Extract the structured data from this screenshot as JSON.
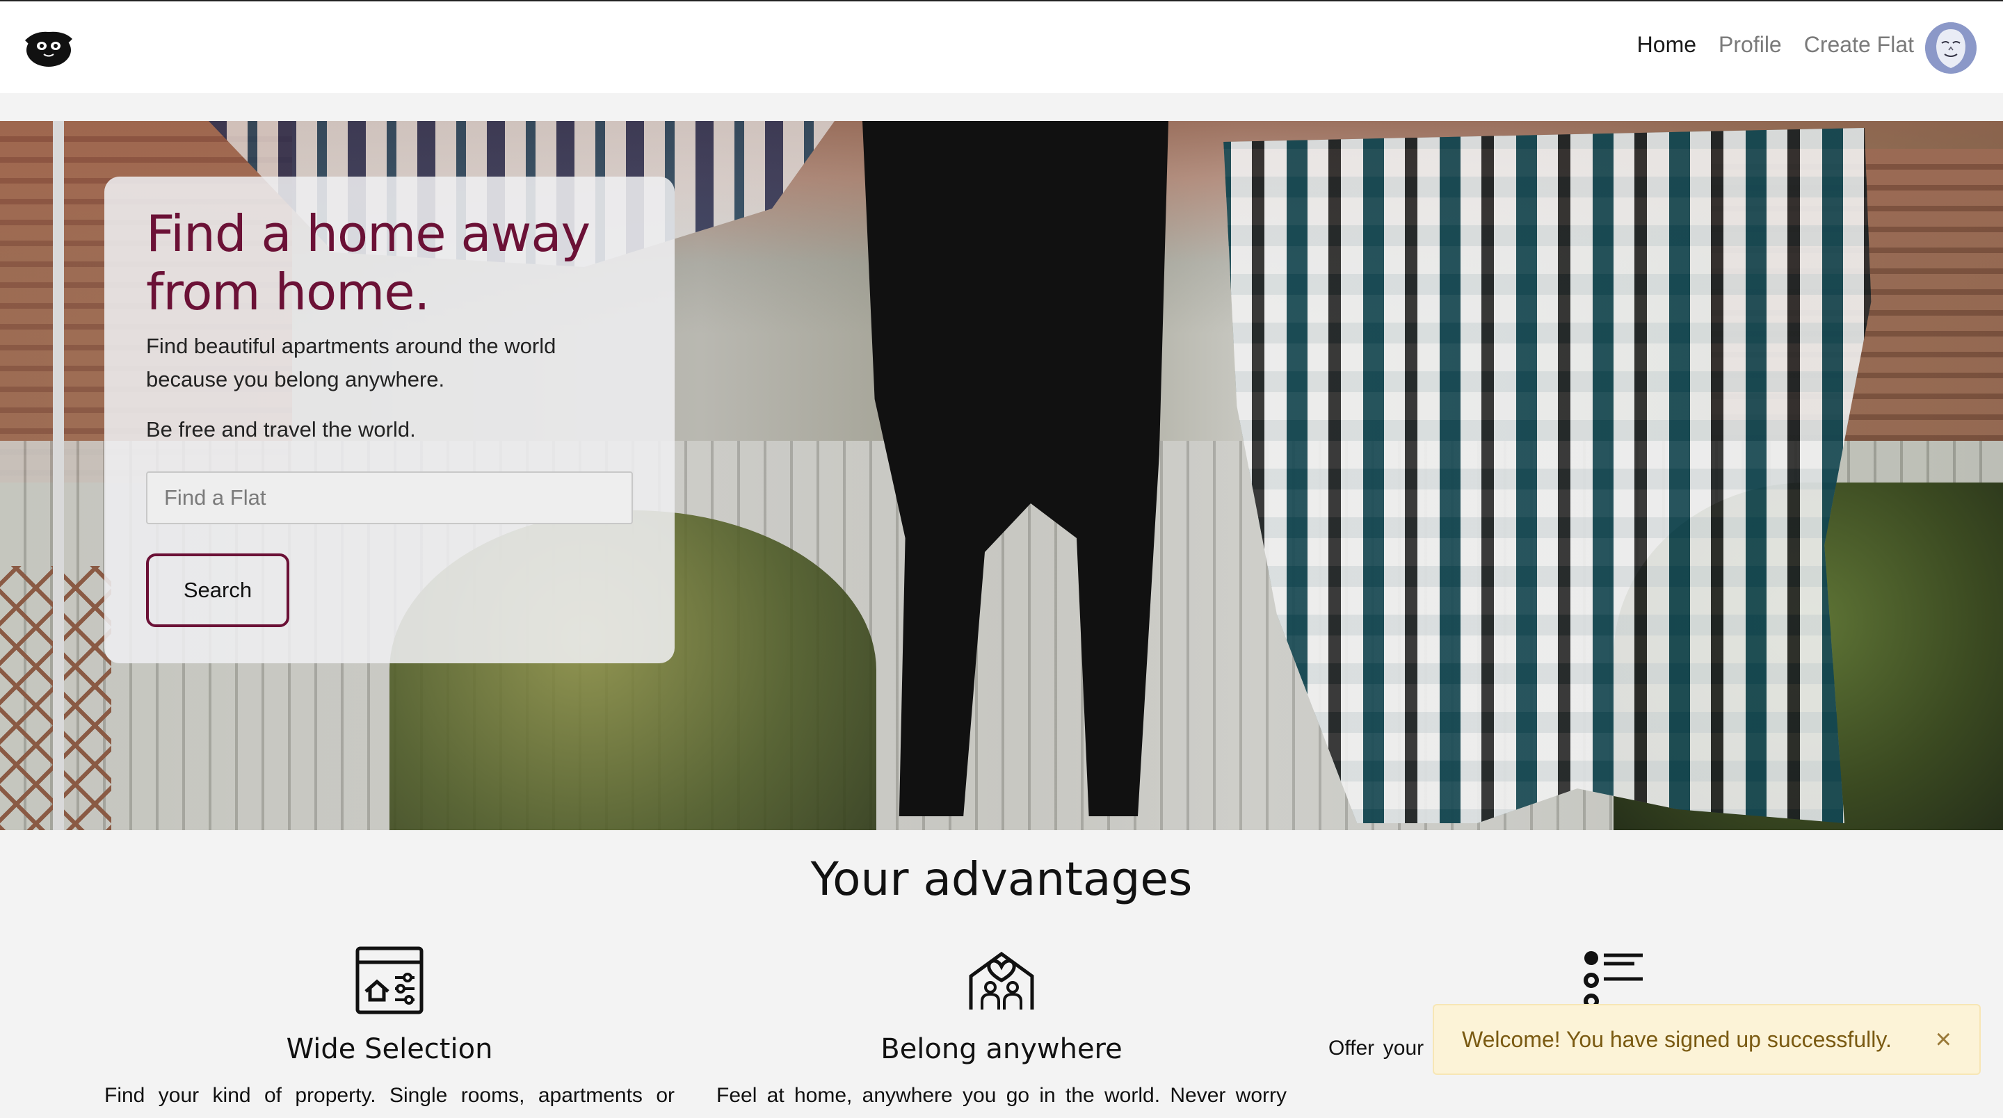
{
  "navbar": {
    "logo_icon": "sloth-logo-icon",
    "links": [
      {
        "label": "Home",
        "active": true
      },
      {
        "label": "Profile",
        "active": false
      },
      {
        "label": "Create Flat",
        "active": false
      }
    ],
    "avatar_icon": "user-avatar-icon"
  },
  "hero": {
    "title": "Find a home away from home.",
    "subtitle": "Find beautiful apartments around the world because you belong anywhere.",
    "tagline": "Be free and travel the world.",
    "search_placeholder": "Find a Flat",
    "search_value": "",
    "search_button": "Search"
  },
  "advantages": {
    "title": "Your advantages",
    "items": [
      {
        "icon": "property-filter-icon",
        "title": "Wide Selection",
        "text": "Find your kind of property. Single rooms, apartments or"
      },
      {
        "icon": "family-home-icon",
        "title": "Belong anywhere",
        "text": "Feel at home, anywhere you go in the world. Never worry"
      },
      {
        "icon": "list-icon",
        "title": "",
        "text": "Offer your home to other people. You don't need to pay for"
      }
    ]
  },
  "toast": {
    "message": "Welcome! You have signed up successfully.",
    "close_icon": "close-icon",
    "close_symbol": "×"
  },
  "colors": {
    "brand": "#6b1136",
    "toast_bg": "#fcf3d7",
    "toast_text": "#7a5a12"
  }
}
